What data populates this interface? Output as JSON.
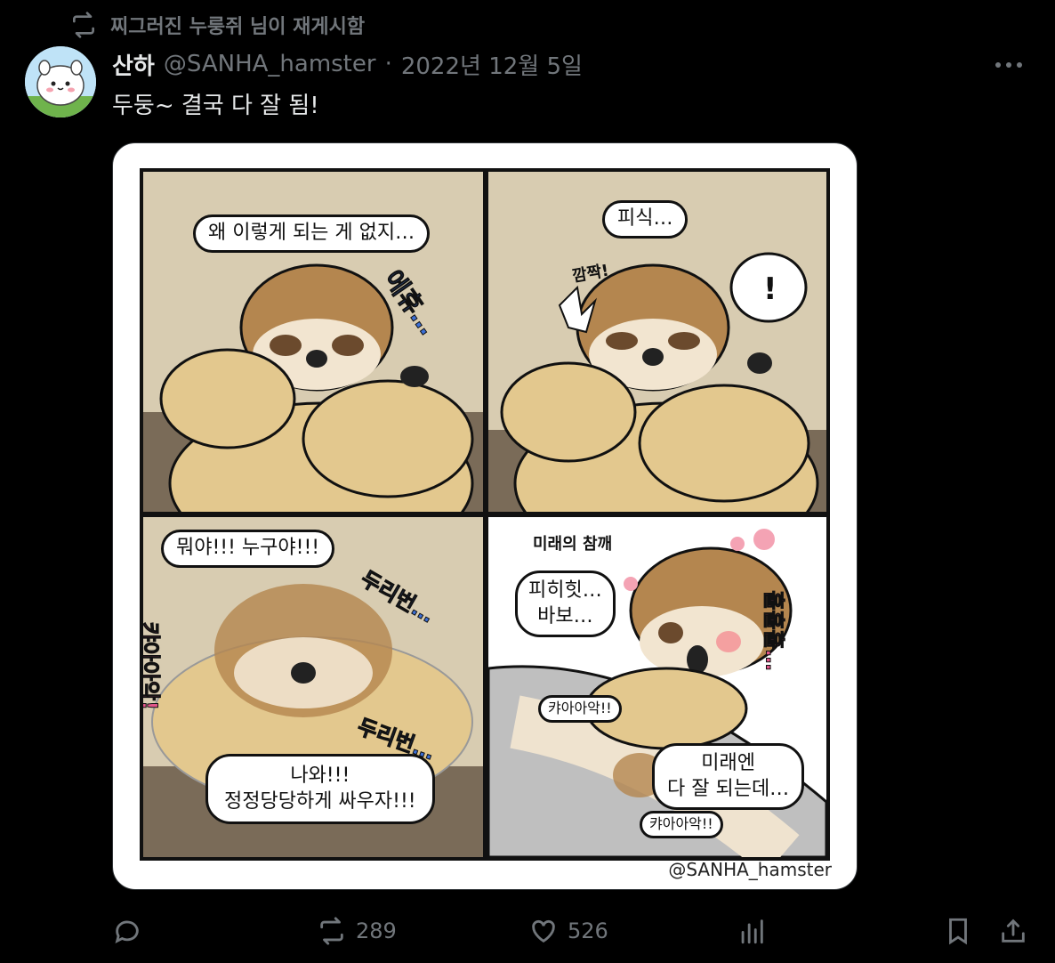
{
  "repost": {
    "text": "찌그러진 누룽쥐 님이 재게시함",
    "icon": "repost-icon"
  },
  "tweet": {
    "display_name": "산하",
    "handle": "@SANHA_hamster",
    "separator": "·",
    "date": "2022년 12월 5일",
    "text": "두둥~ 결국 다 잘 됨!",
    "more_icon": "more-icon"
  },
  "comic": {
    "panel1": {
      "bubble": "왜 이렇게 되는 게 없지…",
      "sfx": "에휴…"
    },
    "panel2": {
      "bubble": "피식…",
      "sfx": "깜짝!",
      "exclaim": "!"
    },
    "panel3": {
      "bubble_top": "뭐야!!! 누구야!!!",
      "sfx_left": "캬아아악!",
      "sfx_top": "두리번…",
      "sfx_bottom": "두리번…",
      "bubble_bottom_1": "나와!!!",
      "bubble_bottom_2": "정정당당하게 싸우자!!!"
    },
    "panel4": {
      "label": "미래의 참깨",
      "bubble_1": "피히힛…",
      "bubble_2": "바보…",
      "sfx_side": "훌훌훌…",
      "scream_1": "캬아아악!!",
      "scream_2": "캬아아악!!",
      "bubble_3": "미래엔",
      "bubble_4": "다 잘 되는데…"
    },
    "watermark": "@SANHA_hamster"
  },
  "actions": {
    "reply": {
      "icon": "reply-icon",
      "count": ""
    },
    "retweet": {
      "icon": "retweet-icon",
      "count": "289"
    },
    "like": {
      "icon": "heart-icon",
      "count": "526"
    },
    "views": {
      "icon": "views-icon",
      "count": ""
    },
    "bookmark": {
      "icon": "bookmark-icon"
    },
    "share": {
      "icon": "share-icon"
    }
  },
  "colors": {
    "background": "#000000",
    "text": "#e7e9ea",
    "muted": "#71767b",
    "hamster": "#b4864f",
    "body": "#e3c88e",
    "wall": "#d8ccb1"
  }
}
